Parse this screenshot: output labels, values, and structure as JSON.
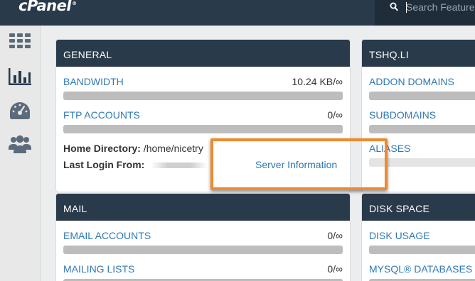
{
  "header": {
    "logo_text": "cPanel",
    "logo_mark": "®",
    "search": {
      "placeholder": "Search Features",
      "icon": "search-icon"
    }
  },
  "sidebar": {
    "items": [
      {
        "icon": "grid-icon",
        "active": false
      },
      {
        "icon": "bar-chart-icon",
        "active": true
      },
      {
        "icon": "gauge-icon",
        "active": false
      },
      {
        "icon": "users-icon",
        "active": false
      }
    ]
  },
  "panels": {
    "general": {
      "title": "GENERAL",
      "stats": [
        {
          "label": "BANDWIDTH",
          "value": "10.24 KB/∞"
        },
        {
          "label": "FTP ACCOUNTS",
          "value": "0/∞"
        }
      ],
      "home_dir_label": "Home Directory:",
      "home_dir_value": "/home/nicetry",
      "last_login_label": "Last Login From:",
      "server_info_link": "Server Information"
    },
    "domains": {
      "title": "TSHQ.LI",
      "stats": [
        {
          "label": "ADDON DOMAINS"
        },
        {
          "label": "SUBDOMAINS"
        },
        {
          "label": "ALIASES"
        }
      ]
    },
    "mail": {
      "title": "MAIL",
      "stats": [
        {
          "label": "EMAIL ACCOUNTS",
          "value": "0/∞"
        },
        {
          "label": "MAILING LISTS",
          "value": "0/∞"
        }
      ]
    },
    "disk": {
      "title": "DISK SPACE",
      "stats": [
        {
          "label": "DISK USAGE"
        },
        {
          "label": "MYSQL® DATABASES"
        }
      ]
    }
  },
  "colors": {
    "header_bg": "#293a4a",
    "link": "#2f78b6",
    "bar": "#bdbdbd",
    "highlight": "#f08a2c"
  }
}
